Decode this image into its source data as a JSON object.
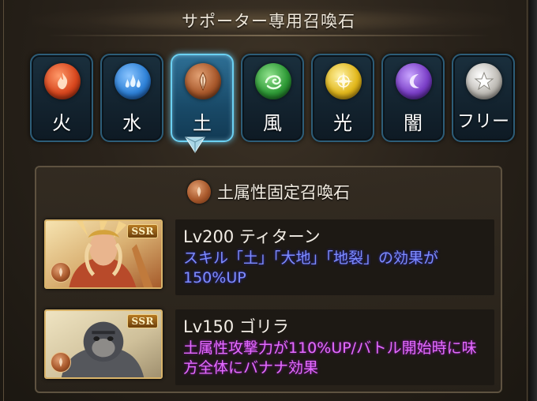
{
  "header": {
    "title": "サポーター専用召喚石"
  },
  "tabs": [
    {
      "label": "火",
      "icon": "fire-icon",
      "color": "#d8471e",
      "active": false
    },
    {
      "label": "水",
      "icon": "water-icon",
      "color": "#2f82d8",
      "active": false
    },
    {
      "label": "土",
      "icon": "earth-icon",
      "color": "#a8582b",
      "active": true
    },
    {
      "label": "風",
      "icon": "wind-icon",
      "color": "#2f9b37",
      "active": false
    },
    {
      "label": "光",
      "icon": "light-icon",
      "color": "#e2b81c",
      "active": false
    },
    {
      "label": "闇",
      "icon": "dark-icon",
      "color": "#7b3fc8",
      "active": false
    },
    {
      "label": "フリー",
      "icon": "star-icon",
      "color": "#bfbcb6",
      "active": false
    }
  ],
  "panel": {
    "title": "土属性固定召喚石",
    "summons": [
      {
        "rarity": "SSR",
        "name": "Lv200 ティターン",
        "description": "スキル「土」「大地」「地裂」の効果が150%UP",
        "desc_color": "#7d8cff"
      },
      {
        "rarity": "SSR",
        "name": "Lv150 ゴリラ",
        "description": "土属性攻撃力が110%UP/バトル開始時に味方全体にバナナ効果",
        "desc_color": "#e36bff"
      }
    ]
  },
  "colors": {
    "accent": "#6bd0f2",
    "panel_border": "#5e5240",
    "card_border": "#d9b46a"
  }
}
